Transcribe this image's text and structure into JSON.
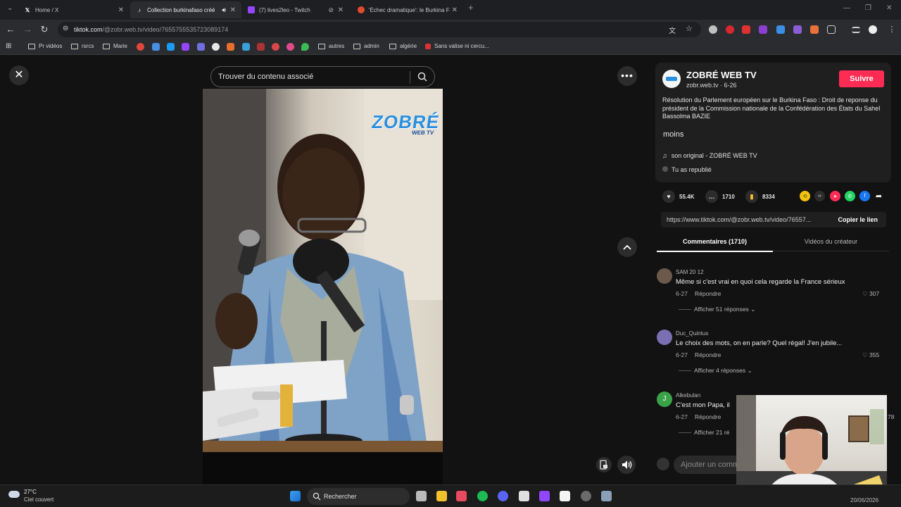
{
  "tabs": [
    {
      "title": "Home / X",
      "icon": "x-logo-icon",
      "active": false
    },
    {
      "title": "Collection burkinafaso créé",
      "icon": "tiktok-icon",
      "active": true
    },
    {
      "title": "(7) lives2leo - Twitch",
      "icon": "twitch-icon",
      "active": false
    },
    {
      "title": "'Échec dramatique': le Burkina F",
      "icon": "news-icon",
      "active": false
    }
  ],
  "address": {
    "domain": "tiktok.com",
    "path": "/@zobr.web.tv/video/7655755535723089174"
  },
  "bookmarks": [
    "Pr vidéos",
    "rsrcs",
    "Marie",
    "autres",
    "admin",
    "algérie",
    "Sans valise ni cercu..."
  ],
  "search": {
    "placeholder": "Trouver du contenu associé"
  },
  "author": {
    "name": "ZOBRÉ WEB TV",
    "handle_date": "zobr.web.tv · 6-26",
    "follow": "Suivre",
    "description": "Résolution du Parlement européen sur le Burkina Faso : Droit de reponse du président de la Commission nationale de la Confédération des États du Sahel Bassolma BAZIE",
    "less": "moins",
    "sound": "son original - ZOBRÉ WEB TV",
    "repost": "Tu as republié"
  },
  "video": {
    "watermark_main": "ZOBRÉ",
    "watermark_sub": "WEB TV"
  },
  "stats": {
    "likes": "55.4K",
    "comments": "1710",
    "saves": "8334"
  },
  "link": {
    "url": "https://www.tiktok.com/@zobr.web.tv/video/76557...",
    "copy": "Copier le lien"
  },
  "panel_tabs": {
    "comments": "Commentaires (1710)",
    "creator": "Vidéos du créateur"
  },
  "comments": [
    {
      "user": "SAM 20 12",
      "text": "Même si c'est vrai en quoi cela regarde la France sérieux",
      "date": "6-27",
      "reply": "Répondre",
      "likes": "307",
      "replies": "Afficher 51 réponses",
      "avatar_color": "#6b5a4a"
    },
    {
      "user": "Duc_Quintus",
      "text": "Le choix des mots, on en parle? Quel régal! J'en jubile...",
      "date": "6-27",
      "reply": "Répondre",
      "likes": "355",
      "replies": "Afficher 4 réponses",
      "avatar_color": "#7a6fb0"
    },
    {
      "user": "Alkebulan",
      "text": "C'est mon Papa, il ",
      "date": "6-27",
      "reply": "Répondre",
      "likes": "78",
      "replies": "Afficher 21 ré",
      "avatar_color": "#3aa34a",
      "avatar_letter": "J"
    }
  ],
  "comment_input": {
    "placeholder": "Ajouter un comm"
  },
  "taskbar": {
    "temp": "27°C",
    "weather": "Ciel couvert",
    "search": "Rechercher",
    "date": "20/06/2026"
  },
  "colors": {
    "accent": "#fe2c55",
    "background": "#121212",
    "card": "#1f1f1f"
  }
}
